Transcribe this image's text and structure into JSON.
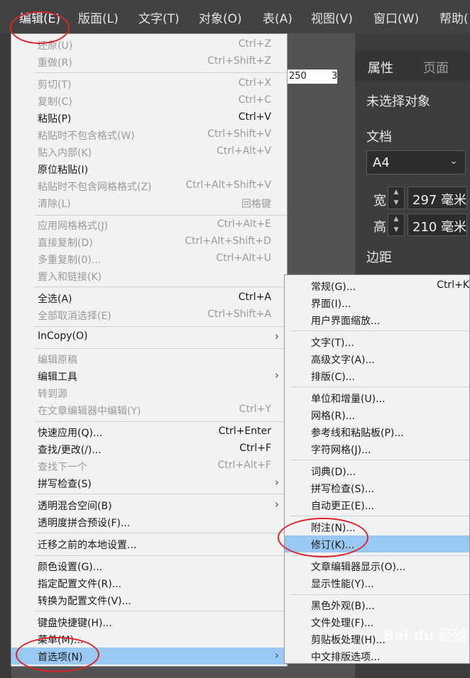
{
  "menubar": {
    "items": [
      {
        "label": "编辑(E)",
        "active": true
      },
      {
        "label": "版面(L)"
      },
      {
        "label": "文字(T)"
      },
      {
        "label": "对象(O)"
      },
      {
        "label": "表(A)"
      },
      {
        "label": "视图(V)"
      },
      {
        "label": "窗口(W)"
      },
      {
        "label": "帮助("
      }
    ]
  },
  "ruler": {
    "mark_250": "250",
    "mark_3": "3"
  },
  "properties_panel": {
    "tabs": [
      "属性",
      "页面"
    ],
    "no_selection": "未选择对象",
    "document_label": "文档",
    "page_size": "A4",
    "width_label": "宽",
    "width_value": "297 毫米",
    "height_label": "高",
    "height_value": "210 毫米",
    "margins_label": "边距"
  },
  "edit_menu": {
    "items": [
      {
        "label": "还原(U)",
        "shortcut": "Ctrl+Z",
        "enabled": false
      },
      {
        "label": "重做(R)",
        "shortcut": "Ctrl+Shift+Z",
        "enabled": false
      },
      {
        "label": "剪切(T)",
        "shortcut": "Ctrl+X",
        "enabled": false
      },
      {
        "label": "复制(C)",
        "shortcut": "Ctrl+C",
        "enabled": false
      },
      {
        "label": "粘贴(P)",
        "shortcut": "Ctrl+V",
        "enabled": true
      },
      {
        "label": "粘贴时不包含格式(W)",
        "shortcut": "Ctrl+Shift+V",
        "enabled": false
      },
      {
        "label": "贴入内部(K)",
        "shortcut": "Ctrl+Alt+V",
        "enabled": false
      },
      {
        "label": "原位粘贴(I)",
        "shortcut": "",
        "enabled": true
      },
      {
        "label": "粘贴时不包含网格格式(Z)",
        "shortcut": "Ctrl+Alt+Shift+V",
        "enabled": false
      },
      {
        "label": "清除(L)",
        "shortcut": "回格键",
        "enabled": false
      },
      {
        "label": "应用网格格式(J)",
        "shortcut": "Ctrl+Alt+E",
        "enabled": false
      },
      {
        "label": "直接复制(D)",
        "shortcut": "Ctrl+Alt+Shift+D",
        "enabled": false
      },
      {
        "label": "多重复制(0)...",
        "shortcut": "Ctrl+Alt+U",
        "enabled": false
      },
      {
        "label": "置入和链接(K)",
        "shortcut": "",
        "enabled": false
      },
      {
        "label": "全选(A)",
        "shortcut": "Ctrl+A",
        "enabled": true
      },
      {
        "label": "全部取消选择(E)",
        "shortcut": "Ctrl+Shift+A",
        "enabled": false
      },
      {
        "label": "InCopy(O)",
        "shortcut": "",
        "enabled": true,
        "submenu": true
      },
      {
        "label": "编辑原稿",
        "shortcut": "",
        "enabled": false
      },
      {
        "label": "编辑工具",
        "shortcut": "",
        "enabled": true,
        "submenu": true
      },
      {
        "label": "转到源",
        "shortcut": "",
        "enabled": false
      },
      {
        "label": "在文章编辑器中编辑(Y)",
        "shortcut": "Ctrl+Y",
        "enabled": false
      },
      {
        "label": "快速应用(Q)...",
        "shortcut": "Ctrl+Enter",
        "enabled": true
      },
      {
        "label": "查找/更改(/)...",
        "shortcut": "Ctrl+F",
        "enabled": true
      },
      {
        "label": "查找下一个",
        "shortcut": "Ctrl+Alt+F",
        "enabled": false
      },
      {
        "label": "拼写检查(S)",
        "shortcut": "",
        "enabled": true,
        "submenu": true
      },
      {
        "label": "透明混合空间(B)",
        "shortcut": "",
        "enabled": true,
        "submenu": true
      },
      {
        "label": "透明度拼合预设(F)...",
        "shortcut": "",
        "enabled": true
      },
      {
        "label": "迁移之前的本地设置...",
        "shortcut": "",
        "enabled": true
      },
      {
        "label": "颜色设置(G)...",
        "shortcut": "",
        "enabled": true
      },
      {
        "label": "指定配置文件(R)...",
        "shortcut": "",
        "enabled": true
      },
      {
        "label": "转换为配置文件(V)...",
        "shortcut": "",
        "enabled": true
      },
      {
        "label": "键盘快捷键(H)...",
        "shortcut": "",
        "enabled": true
      },
      {
        "label": "菜单(M)...",
        "shortcut": "",
        "enabled": true
      },
      {
        "label": "首选项(N)",
        "shortcut": "",
        "enabled": true,
        "submenu": true,
        "highlighted": true
      }
    ]
  },
  "preferences_submenu": {
    "items": [
      {
        "label": "常规(G)...",
        "shortcut": "Ctrl+K"
      },
      {
        "label": "界面(I)...",
        "shortcut": ""
      },
      {
        "label": "用户界面缩放...",
        "shortcut": ""
      },
      {
        "label": "文字(T)...",
        "shortcut": ""
      },
      {
        "label": "高级文字(A)...",
        "shortcut": ""
      },
      {
        "label": "排版(C)...",
        "shortcut": ""
      },
      {
        "label": "单位和增量(U)...",
        "shortcut": ""
      },
      {
        "label": "网格(R)...",
        "shortcut": ""
      },
      {
        "label": "参考线和粘贴板(P)...",
        "shortcut": ""
      },
      {
        "label": "字符网格(J)...",
        "shortcut": ""
      },
      {
        "label": "词典(D)...",
        "shortcut": ""
      },
      {
        "label": "拼写检查(S)...",
        "shortcut": ""
      },
      {
        "label": "自动更正(E)...",
        "shortcut": ""
      },
      {
        "label": "附注(N)...",
        "shortcut": ""
      },
      {
        "label": "修订(K)...",
        "shortcut": "",
        "highlighted": true
      },
      {
        "label": "文章编辑器显示(O)...",
        "shortcut": ""
      },
      {
        "label": "显示性能(Y)...",
        "shortcut": ""
      },
      {
        "label": "黑色外观(B)...",
        "shortcut": ""
      },
      {
        "label": "文件处理(F)...",
        "shortcut": ""
      },
      {
        "label": "剪贴板处理(H)...",
        "shortcut": ""
      },
      {
        "label": "中文排版选项...",
        "shortcut": ""
      }
    ]
  },
  "watermark": "Bai du 经验",
  "colors": {
    "menu_bg": "#f2f2f2",
    "highlight": "#99c9f3",
    "annotation_circle": "#d9252a",
    "app_bg": "#535353"
  }
}
